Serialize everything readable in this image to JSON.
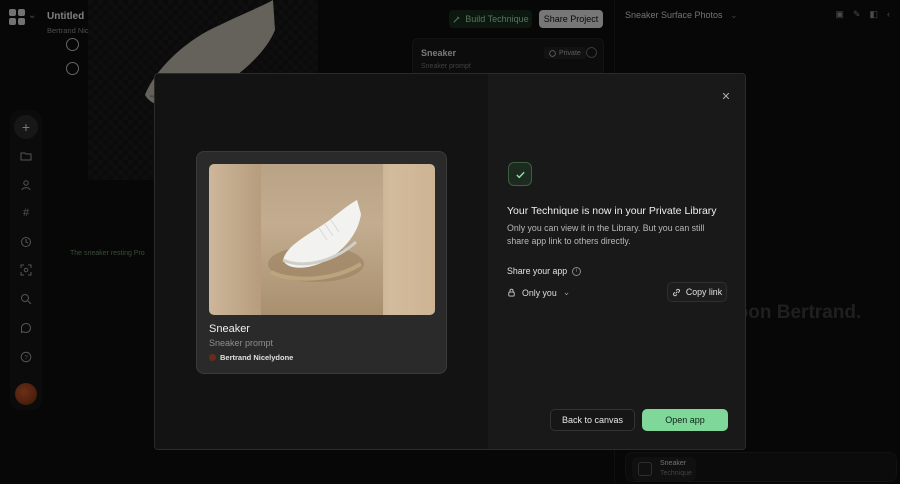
{
  "header": {
    "project_title": "Untitled",
    "workspace": "Bertrand Nicelydone's workspace",
    "build_label": "Build Technique",
    "share_label": "Share Project"
  },
  "canvas": {
    "note": "The sneaker resting Pro"
  },
  "background_card": {
    "title": "Sneaker",
    "subtitle": "Sneaker prompt",
    "visibility": "Private"
  },
  "right_panel": {
    "title": "Sneaker Surface Photos",
    "greeting": "Good afternoon Bertrand.",
    "chip_title": "Sneaker",
    "chip_subtitle": "Technique"
  },
  "modal": {
    "card": {
      "title": "Sneaker",
      "subtitle": "Sneaker prompt",
      "author": "Bertrand Nicelydone"
    },
    "success_title": "Your Technique is now in your Private Library",
    "success_body": "Only you can view it in the Library. But you can still share app link to others directly.",
    "share_label": "Share your app",
    "access_value": "Only you",
    "copy_link_label": "Copy link",
    "back_label": "Back to canvas",
    "open_label": "Open app"
  },
  "colors": {
    "accent_green": "#7fd79a",
    "background": "#0d0d0d",
    "modal_left": "#131313",
    "modal_right": "#191919"
  },
  "icons": [
    "logo-icon",
    "chevron-down-icon",
    "plus-icon",
    "folder-icon",
    "user-icon",
    "hash-icon",
    "history-icon",
    "scan-icon",
    "search-icon",
    "chat-icon",
    "help-icon",
    "globe-icon",
    "info-icon",
    "close-icon",
    "check-icon",
    "lock-icon",
    "link-icon"
  ]
}
